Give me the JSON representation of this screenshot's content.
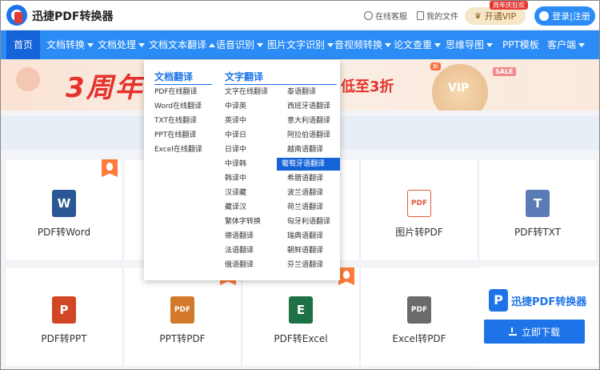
{
  "header": {
    "brand": "迅捷PDF转换器",
    "service_label": "在线客服",
    "files_label": "我的文件",
    "vip_badge": "周年庆狂欢",
    "vip_label": "开通VIP",
    "login_label": "登录|注册"
  },
  "nav": {
    "items": [
      {
        "label": "首页",
        "caret": false
      },
      {
        "label": "文档转换",
        "caret": true
      },
      {
        "label": "文档处理",
        "caret": true
      },
      {
        "label": "文档文本翻译",
        "caret": true
      },
      {
        "label": "语音识别",
        "caret": true
      },
      {
        "label": "图片文字识别",
        "caret": true
      },
      {
        "label": "音视频转换",
        "caret": true
      },
      {
        "label": "论文查重",
        "caret": true
      },
      {
        "label": "思维导图",
        "caret": true
      },
      {
        "label": "PPT模板",
        "caret": false
      },
      {
        "label": "客户端",
        "caret": true
      }
    ],
    "new_tag": "新"
  },
  "banner": {
    "big_text": "3周年",
    "sub_text": "低至3折",
    "vip_text": "VIP",
    "sale_text": "SALE"
  },
  "dropdown": {
    "doc_header": "文档翻译",
    "doc_items": [
      "PDF在线翻译",
      "Word在线翻译",
      "TXT在线翻译",
      "PPT在线翻译",
      "Excel在线翻译"
    ],
    "text_header": "文字翻译",
    "text_col1": [
      "文字在线翻译",
      "中译英",
      "英译中",
      "中译日",
      "日译中",
      "中译韩",
      "韩译中",
      "汉译藏",
      "藏译汉",
      "繁体字转换",
      "德语翻译",
      "法语翻译",
      "俄语翻译"
    ],
    "text_col2": [
      "泰语翻译",
      "西班牙语翻译",
      "意大利语翻译",
      "阿拉伯语翻译",
      "越南语翻译",
      "葡萄牙语翻译",
      "希腊语翻译",
      "波兰语翻译",
      "荷兰语翻译",
      "匈牙利语翻译",
      "瑞典语翻译",
      "朝鲜语翻译",
      "芬兰语翻译"
    ],
    "highlighted": "葡萄牙语翻译"
  },
  "cards": {
    "row1": [
      "PDF转Word",
      "图片转PDF",
      "PDF转TXT"
    ],
    "row2": [
      "PDF转PPT",
      "PPT转PDF",
      "PDF转Excel",
      "Excel转PDF"
    ],
    "icons": {
      "word": "W",
      "pdf": "PDF",
      "txt": "T",
      "ppt": "P",
      "excel": "E"
    }
  },
  "promo": {
    "title": "迅捷PDF转换器",
    "logo": "P",
    "button": "立即下载"
  },
  "colors": {
    "nav_bg": "#2b8cf6",
    "nav_active": "#1563d8",
    "word": "#2b5797",
    "ppt": "#d24726",
    "excel": "#1e7145",
    "pdf": "#e05a3a",
    "txt": "#5a7bb5"
  }
}
